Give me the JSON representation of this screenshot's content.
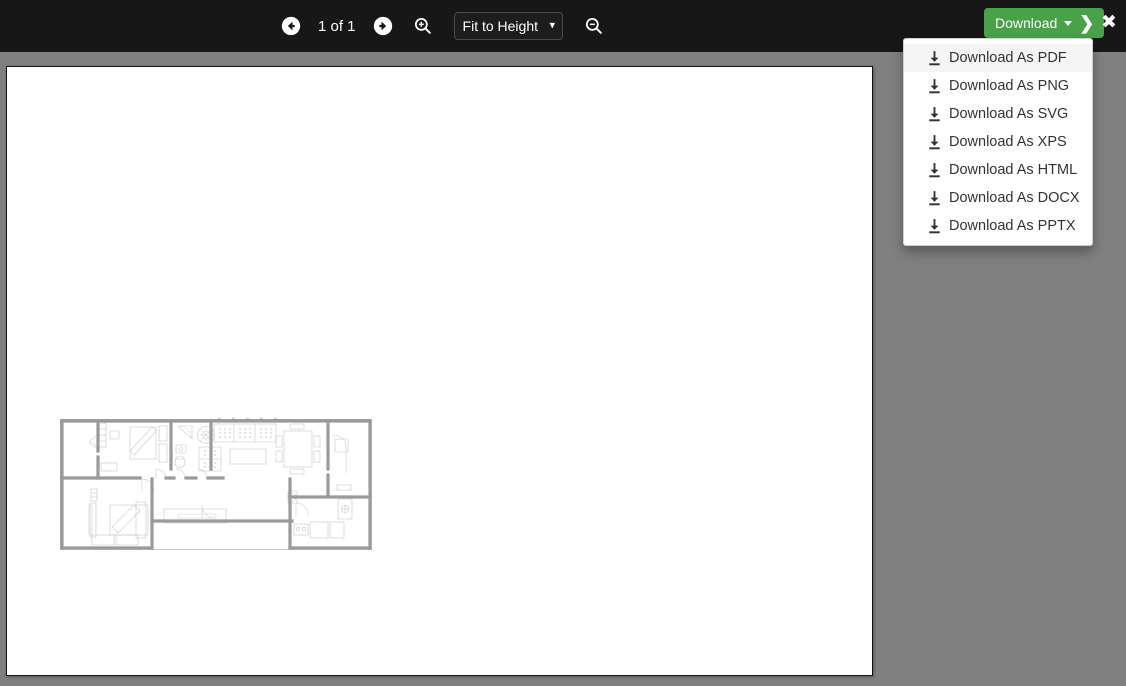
{
  "toolbar": {
    "prev_page_icon": "arrow-circle-left-icon",
    "page_indicator": "1 of 1",
    "next_page_icon": "arrow-circle-right-icon",
    "zoom_in_icon": "magnifier-plus-icon",
    "zoom_out_icon": "magnifier-minus-icon",
    "fit_select": {
      "value": "Fit to Height",
      "caret_icon": "chevron-down-icon",
      "options": [
        "Fit to Height"
      ]
    },
    "background_color": "#171717"
  },
  "download": {
    "label": "Download",
    "caret_icon": "caret-down-icon",
    "chevron_icon": "chevron-right-icon",
    "button_color": "#49a24a",
    "menu": {
      "items": [
        {
          "label": "Download As PDF",
          "icon": "download-icon",
          "active": true
        },
        {
          "label": "Download As PNG",
          "icon": "download-icon",
          "active": false
        },
        {
          "label": "Download As SVG",
          "icon": "download-icon",
          "active": false
        },
        {
          "label": "Download As XPS",
          "icon": "download-icon",
          "active": false
        },
        {
          "label": "Download As HTML",
          "icon": "download-icon",
          "active": false
        },
        {
          "label": "Download As DOCX",
          "icon": "download-icon",
          "active": false
        },
        {
          "label": "Download As PPTX",
          "icon": "download-icon",
          "active": false
        }
      ]
    }
  },
  "close": {
    "icon": "close-icon",
    "label": "✖"
  },
  "viewer": {
    "background_color": "#808080",
    "page_background": "#ffffff",
    "document": {
      "type": "architectural-floor-plan",
      "description": "Apartment floor plan drawing with bedrooms, bathrooms, living/dining room and kitchen",
      "wall_color": "#9a9a9a",
      "furniture_color": "#d8d8d8"
    }
  }
}
